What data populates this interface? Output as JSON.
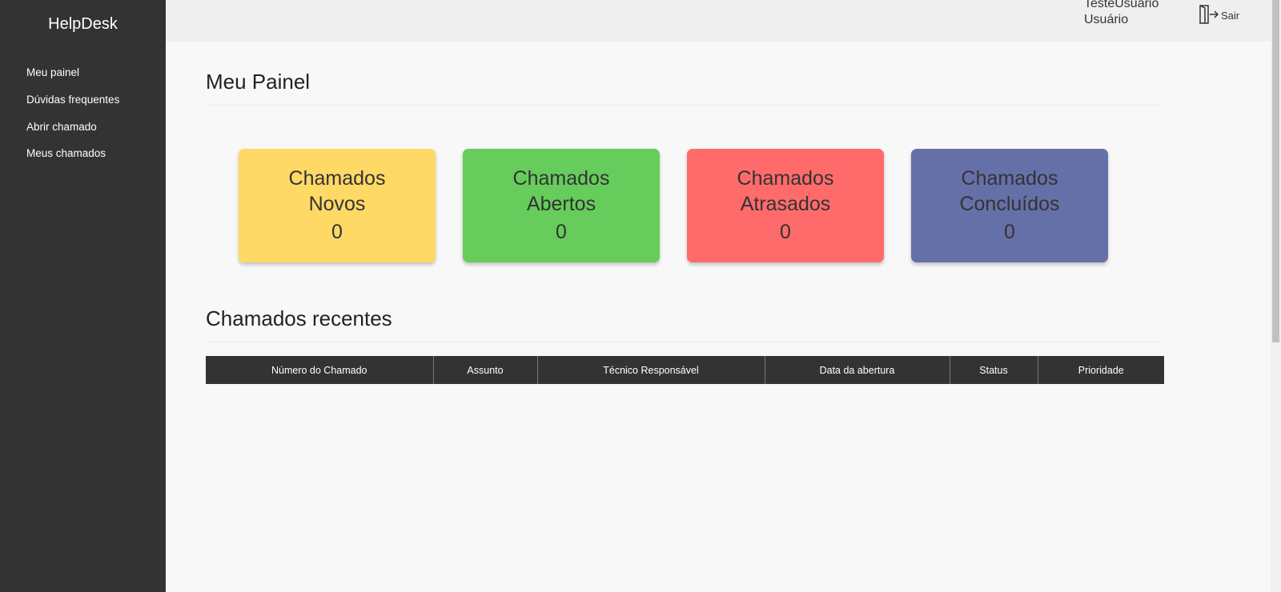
{
  "sidebar": {
    "brand": "HelpDesk",
    "items": [
      {
        "label": "Meu painel"
      },
      {
        "label": "Dúvidas frequentes"
      },
      {
        "label": "Abrir chamado"
      },
      {
        "label": "Meus chamados"
      }
    ]
  },
  "header": {
    "user_name": "TesteUsuario",
    "user_role": "Usuário",
    "logout_label": "Sair",
    "logout_icon": "door-exit-icon"
  },
  "main": {
    "title": "Meu Painel",
    "cards": [
      {
        "line1": "Chamados",
        "line2": "Novos",
        "value": "0",
        "color": "#ffd966"
      },
      {
        "line1": "Chamados",
        "line2": "Abertos",
        "value": "0",
        "color": "#66cc5b"
      },
      {
        "line1": "Chamados",
        "line2": "Atrasados",
        "value": "0",
        "color": "#ff6b6b"
      },
      {
        "line1": "Chamados",
        "line2": "Concluídos",
        "value": "0",
        "color": "#6670a8"
      }
    ],
    "recent_title": "Chamados recentes",
    "table": {
      "columns": [
        "Número do Chamado",
        "Assunto",
        "Técnico Responsável",
        "Data da abertura",
        "Status",
        "Prioridade"
      ],
      "rows": []
    }
  },
  "colors": {
    "sidebar_bg": "#333333",
    "topbar_bg": "#efefef",
    "page_bg": "#f8f8f8"
  }
}
